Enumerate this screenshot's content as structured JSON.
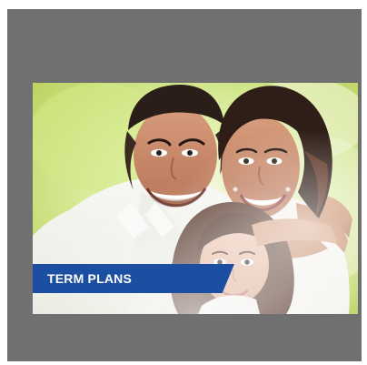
{
  "card": {
    "banner_text": "TERM PLANS",
    "colors": {
      "frame_bg": "#707070",
      "banner_bg": "#1c4ea1",
      "banner_text": "#ffffff",
      "photo_glow": "#dff5a2"
    },
    "image_semantics": "family-photo"
  }
}
